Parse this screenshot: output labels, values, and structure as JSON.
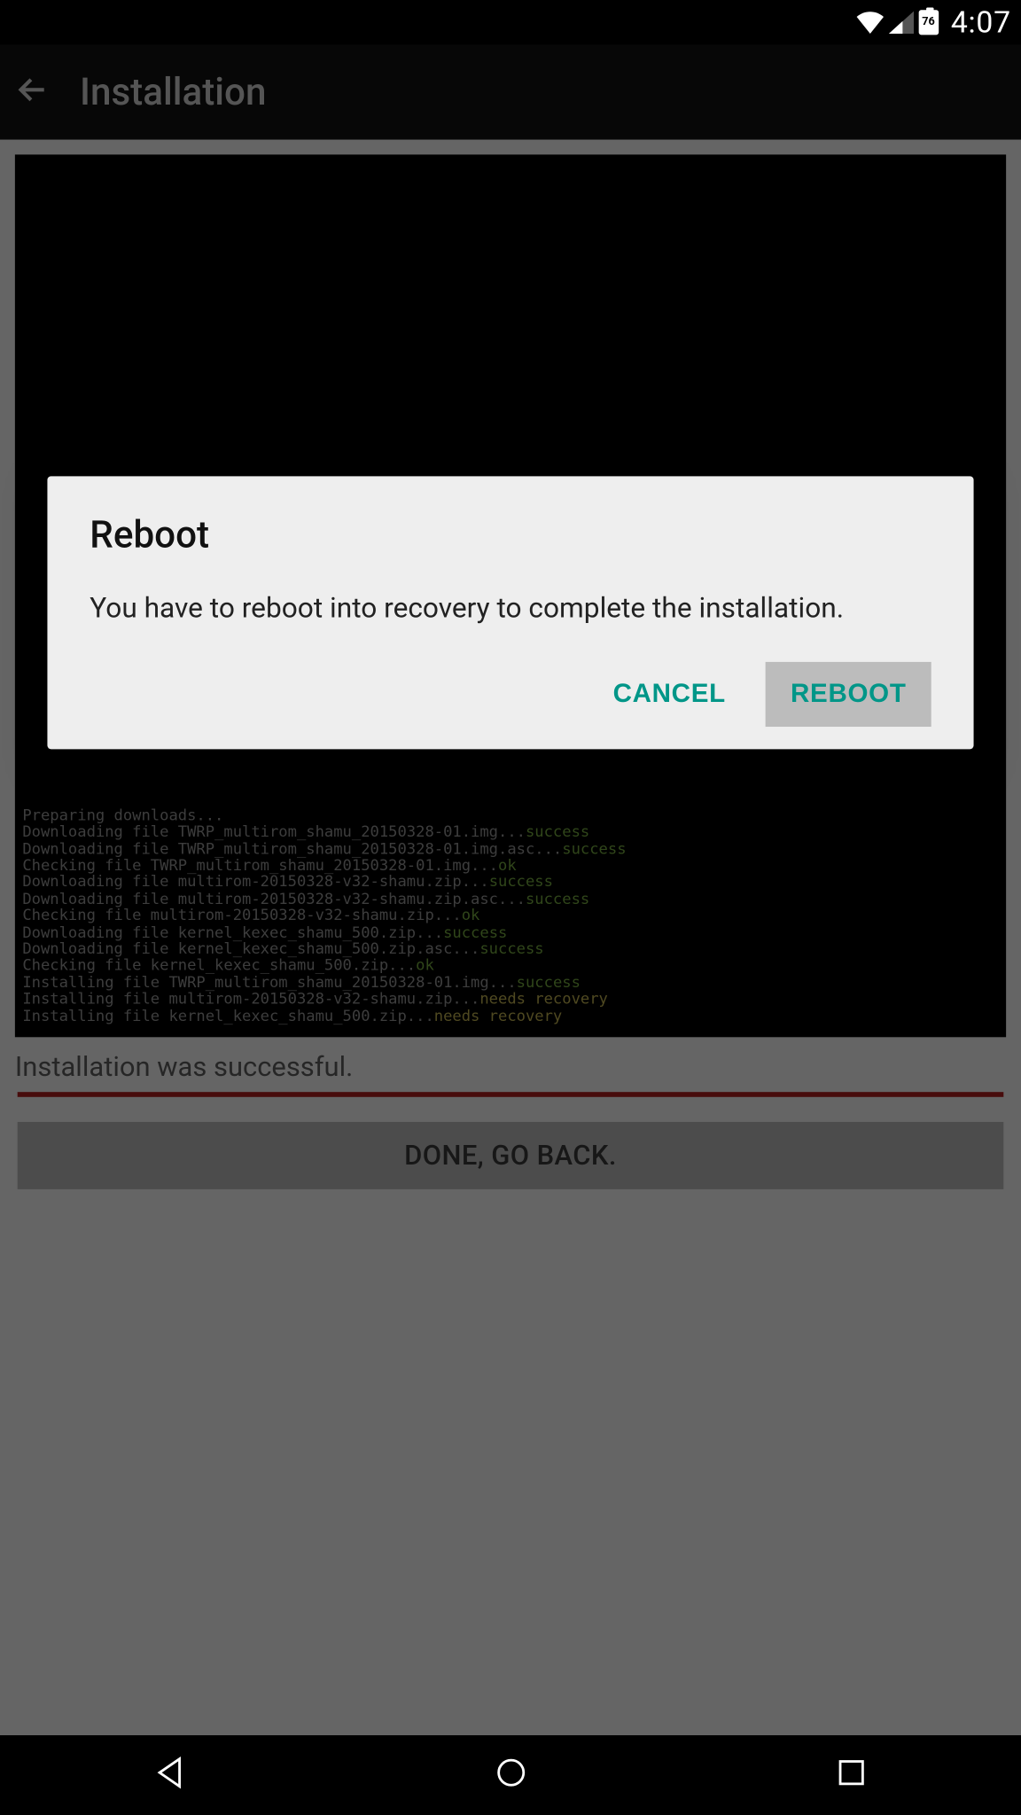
{
  "statusbar": {
    "battery": "76",
    "clock": "4:07"
  },
  "appbar": {
    "title": "Installation"
  },
  "terminal": {
    "lines": [
      {
        "text": "Preparing downloads...",
        "status": ""
      },
      {
        "text": "Downloading file TWRP_multirom_shamu_20150328-01.img...",
        "status": "success"
      },
      {
        "text": "Downloading file TWRP_multirom_shamu_20150328-01.img.asc...",
        "status": "success"
      },
      {
        "text": "Checking file TWRP_multirom_shamu_20150328-01.img...",
        "status": "ok"
      },
      {
        "text": "Downloading file multirom-20150328-v32-shamu.zip...",
        "status": "success"
      },
      {
        "text": "Downloading file multirom-20150328-v32-shamu.zip.asc...",
        "status": "success"
      },
      {
        "text": "Checking file multirom-20150328-v32-shamu.zip...",
        "status": "ok"
      },
      {
        "text": "Downloading file kernel_kexec_shamu_500.zip...",
        "status": "success"
      },
      {
        "text": "Downloading file kernel_kexec_shamu_500.zip.asc...",
        "status": "success"
      },
      {
        "text": "Checking file kernel_kexec_shamu_500.zip...",
        "status": "ok"
      },
      {
        "text": "Installing file TWRP_multirom_shamu_20150328-01.img...",
        "status": "success"
      },
      {
        "text": "Installing file multirom-20150328-v32-shamu.zip...",
        "status": "needs recovery"
      },
      {
        "text": "Installing file kernel_kexec_shamu_500.zip...",
        "status": "needs recovery"
      }
    ]
  },
  "status_text": "Installation was successful.",
  "done_button": "DONE, GO BACK.",
  "dialog": {
    "title": "Reboot",
    "message": "You have to reboot into recovery to complete the installation.",
    "cancel": "CANCEL",
    "confirm": "REBOOT"
  }
}
